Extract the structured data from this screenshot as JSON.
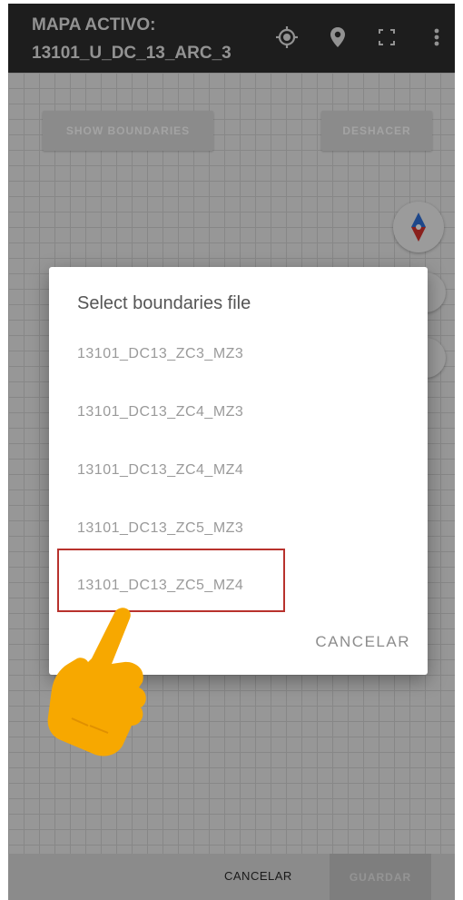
{
  "appbar": {
    "title_line1": "MAPA ACTIVO:",
    "title_line2": "13101_U_DC_13_ARC_3",
    "icons": [
      "gps-target-icon",
      "map-pin-icon",
      "fullscreen-icon",
      "overflow-menu-icon"
    ]
  },
  "map": {
    "show_boundaries_label": "SHOW BOUNDARIES",
    "undo_label": "DESHACER",
    "compass_icon": "compass-icon"
  },
  "dialog": {
    "title": "Select boundaries file",
    "options": [
      "13101_DC13_ZC3_MZ3",
      "13101_DC13_ZC4_MZ3",
      "13101_DC13_ZC4_MZ4",
      "13101_DC13_ZC5_MZ3",
      "13101_DC13_ZC5_MZ4"
    ],
    "highlighted_option_index": 4,
    "cancel_label": "CANCELAR"
  },
  "bottombar": {
    "cancel_label": "CANCELAR",
    "save_label": "GUARDAR"
  },
  "colors": {
    "appbar_bg": "#2e2e2e",
    "highlight_border": "#b8322d",
    "hand_fill": "#f7a800",
    "compass_north": "#2f6fd8",
    "compass_south": "#d8322d"
  },
  "overlay_icon": "pointing-hand-icon"
}
